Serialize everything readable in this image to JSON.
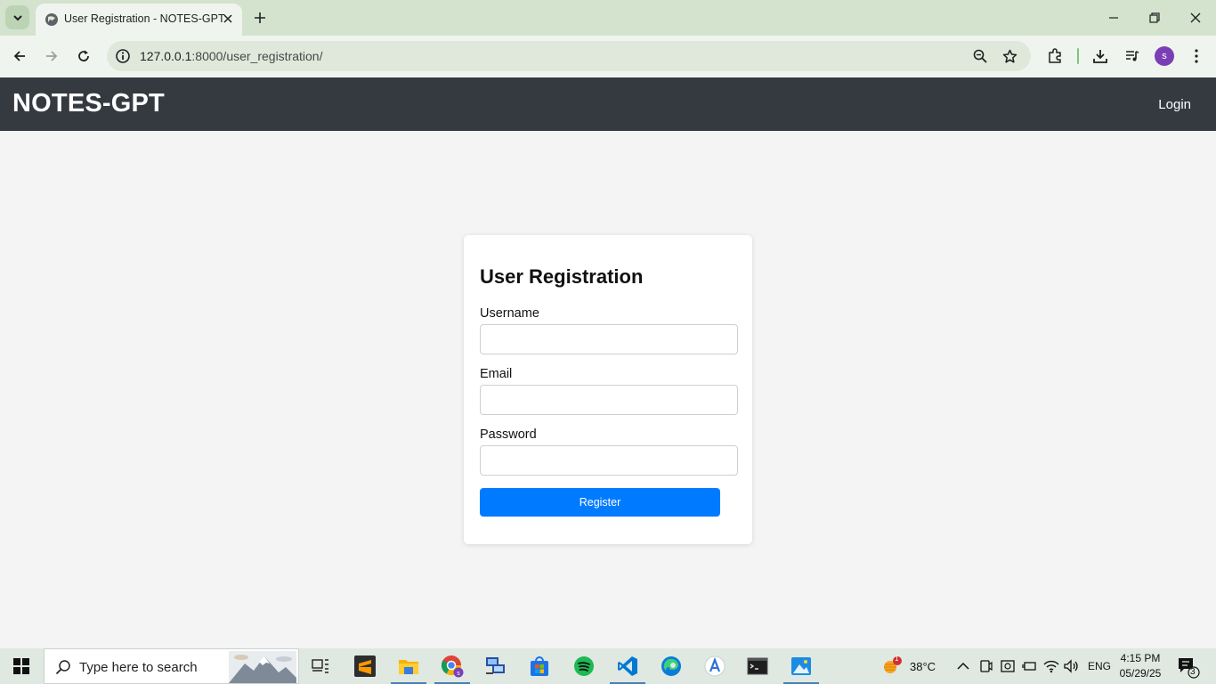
{
  "browser": {
    "tab_title": "User Registration - NOTES-GPT",
    "url_host": "127.0.0.1",
    "url_path": ":8000/user_registration/",
    "profile_initial": "s",
    "accent_color": "#d3e3cd"
  },
  "header": {
    "brand": "NOTES-GPT",
    "login_label": "Login"
  },
  "form": {
    "title": "User Registration",
    "username_label": "Username",
    "username_value": "",
    "email_label": "Email",
    "email_value": "",
    "password_label": "Password",
    "password_value": "",
    "register_label": "Register",
    "button_color": "#007bff"
  },
  "taskbar": {
    "search_placeholder": "Type here to search",
    "weather_temp": "38°C",
    "weather_badge": "1",
    "language": "ENG",
    "time": "4:15 PM",
    "date": "05/29/25",
    "notification_count": "3",
    "pinned_apps": [
      "task-view",
      "sublime-text",
      "file-explorer",
      "chrome",
      "network-tool",
      "microsoft-store",
      "spotify",
      "vs-code",
      "edge",
      "app-installer",
      "terminal",
      "photos"
    ]
  }
}
